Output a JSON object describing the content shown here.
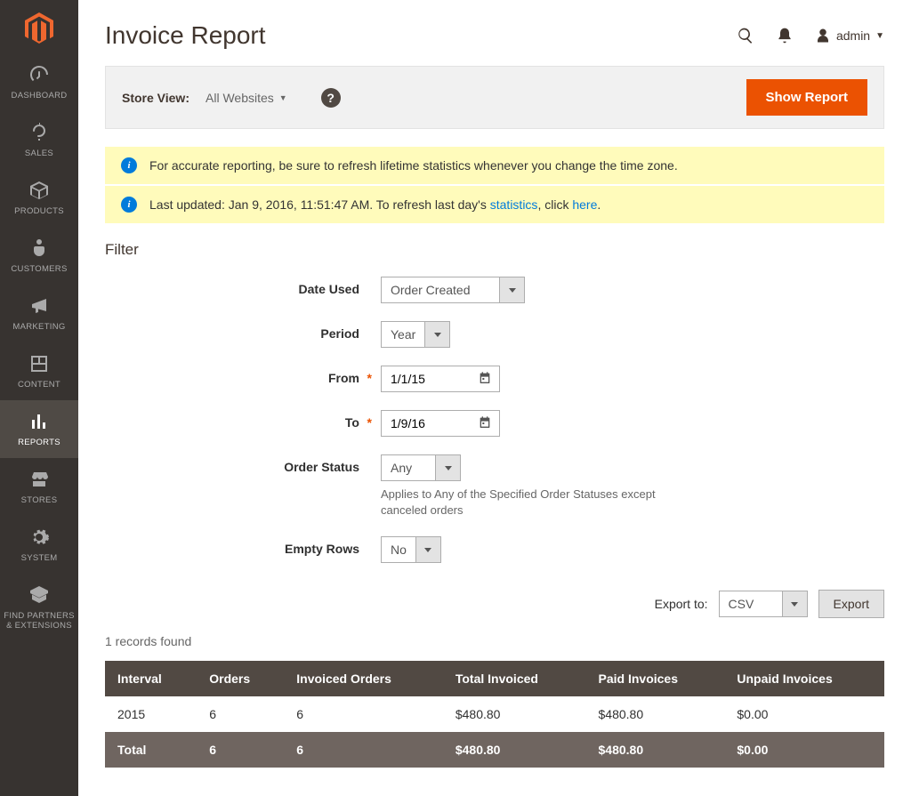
{
  "nav": [
    {
      "label": "DASHBOARD"
    },
    {
      "label": "SALES"
    },
    {
      "label": "PRODUCTS"
    },
    {
      "label": "CUSTOMERS"
    },
    {
      "label": "MARKETING"
    },
    {
      "label": "CONTENT"
    },
    {
      "label": "REPORTS"
    },
    {
      "label": "STORES"
    },
    {
      "label": "SYSTEM"
    },
    {
      "label": "FIND PARTNERS & EXTENSIONS"
    }
  ],
  "header": {
    "title": "Invoice Report",
    "admin": "admin"
  },
  "toolbar": {
    "store_view_label": "Store View:",
    "store_view_value": "All Websites",
    "show_report": "Show Report"
  },
  "messages": {
    "m1": "For accurate reporting, be sure to refresh lifetime statistics whenever you change the time zone.",
    "m2_a": "Last updated: Jan 9, 2016, 11:51:47 AM. To refresh last day's ",
    "m2_link1": "statistics",
    "m2_b": ", click ",
    "m2_link2": "here",
    "m2_c": "."
  },
  "filter": {
    "title": "Filter",
    "date_used": {
      "label": "Date Used",
      "value": "Order Created"
    },
    "period": {
      "label": "Period",
      "value": "Year"
    },
    "from": {
      "label": "From",
      "value": "1/1/15"
    },
    "to": {
      "label": "To",
      "value": "1/9/16"
    },
    "order_status": {
      "label": "Order Status",
      "value": "Any",
      "hint": "Applies to Any of the Specified Order Statuses except canceled orders"
    },
    "empty_rows": {
      "label": "Empty Rows",
      "value": "No"
    }
  },
  "export": {
    "label": "Export to:",
    "format": "CSV",
    "button": "Export"
  },
  "records": "1 records found",
  "table": {
    "headers": {
      "interval": "Interval",
      "orders": "Orders",
      "invoiced": "Invoiced Orders",
      "total": "Total Invoiced",
      "paid": "Paid Invoices",
      "unpaid": "Unpaid Invoices"
    },
    "row": {
      "interval": "2015",
      "orders": "6",
      "invoiced": "6",
      "total": "$480.80",
      "paid": "$480.80",
      "unpaid": "$0.00"
    },
    "totals": {
      "interval": "Total",
      "orders": "6",
      "invoiced": "6",
      "total": "$480.80",
      "paid": "$480.80",
      "unpaid": "$0.00"
    }
  }
}
